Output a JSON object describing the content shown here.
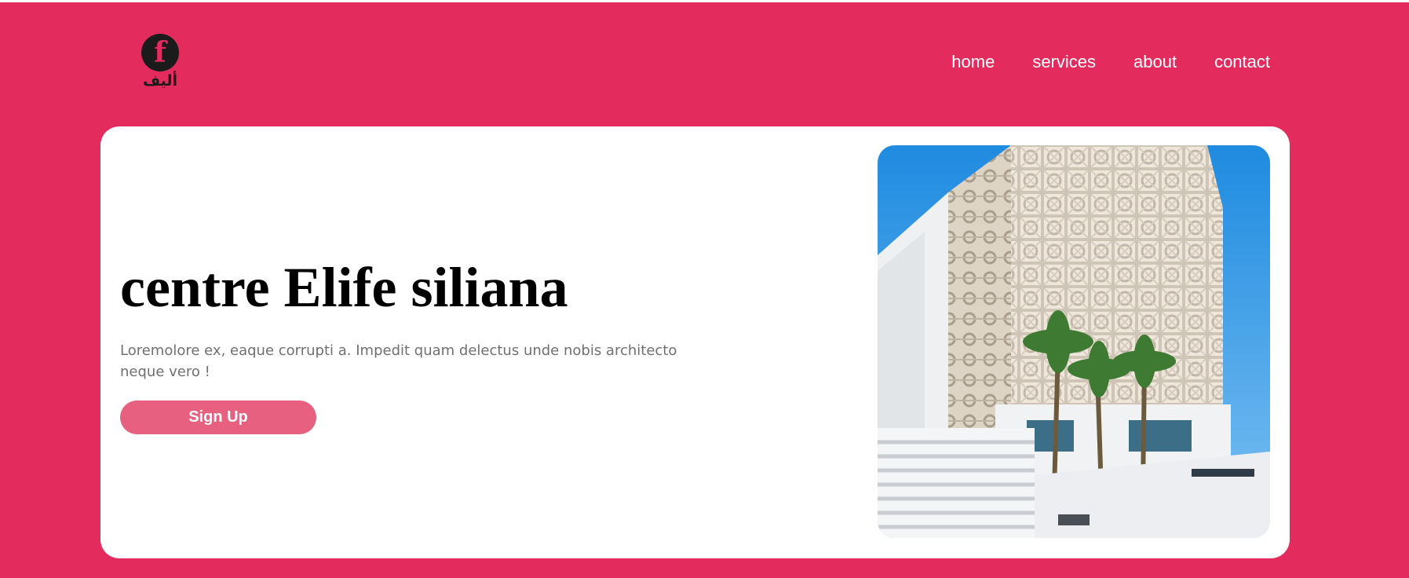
{
  "brand": {
    "logo_glyph": "f",
    "logo_text": "أليف"
  },
  "nav": {
    "items": [
      "home",
      "services",
      "about",
      "contact"
    ]
  },
  "hero": {
    "title": "centre Elife siliana",
    "description": "Loremolore ex, eaque corrupti a. Impedit quam delectus unde nobis architecto neque vero !",
    "button_label": "Sign Up",
    "image_alt": "building photo"
  },
  "colors": {
    "primary": "#e42b5d",
    "button": "#e7607f",
    "card": "#ffffff",
    "text_muted": "#707070"
  }
}
